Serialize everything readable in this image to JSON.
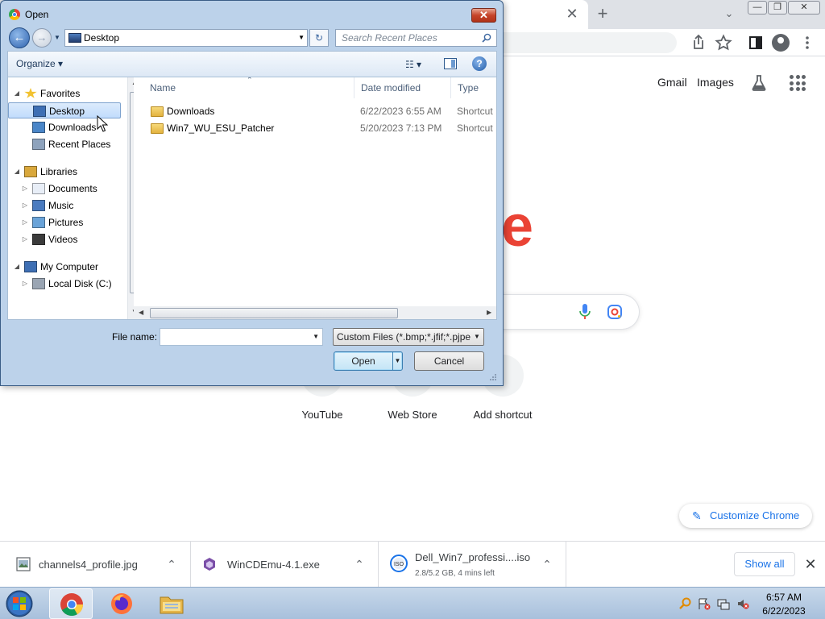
{
  "chrome": {
    "tab_close_glyph": "✕",
    "newtab_glyph": "+",
    "tab_search_glyph": "⌄",
    "window_controls": [
      "—",
      "❐",
      "✕"
    ],
    "toolbar_icons": [
      "share-icon",
      "star-icon",
      "sidepanel-icon",
      "profile-icon",
      "menu-icon"
    ],
    "ntp_links": {
      "gmail": "Gmail",
      "images": "Images"
    },
    "logo_fragment": "e",
    "shortcuts": [
      {
        "label": "YouTube"
      },
      {
        "label": "Web Store"
      },
      {
        "label": "Add shortcut"
      }
    ],
    "customize_label": "Customize Chrome"
  },
  "downloads": {
    "items": [
      {
        "name": "channels4_profile.jpg",
        "status": "",
        "icon": "image-file-icon"
      },
      {
        "name": "WinCDEmu-4.1.exe",
        "status": "",
        "icon": "exe-file-icon"
      },
      {
        "name": "Dell_Win7_professi....iso",
        "status": "2.8/5.2 GB, 4 mins left",
        "icon": "iso-file-icon"
      }
    ],
    "show_all_label": "Show all",
    "close_glyph": "✕"
  },
  "taskbar": {
    "time": "6:57 AM",
    "date": "6/22/2023",
    "apps": [
      "chrome",
      "firefox",
      "explorer"
    ],
    "active_app": "chrome"
  },
  "dialog": {
    "title": "Open",
    "close_glyph": "✕",
    "address": "Desktop",
    "search_placeholder": "Search Recent Places",
    "organize_label": "Organize ▾",
    "view_glyph": "☷ ▾",
    "help_glyph": "?",
    "nav_tree": [
      {
        "label": "Favorites",
        "level": 0,
        "arrow": "◢",
        "icon": "star",
        "selected": false
      },
      {
        "label": "Desktop",
        "level": 1,
        "arrow": "",
        "icon": "desktop",
        "selected": true
      },
      {
        "label": "Downloads",
        "level": 1,
        "arrow": "",
        "icon": "downloads",
        "selected": false
      },
      {
        "label": "Recent Places",
        "level": 1,
        "arrow": "",
        "icon": "recent",
        "selected": false
      },
      {
        "label": "Libraries",
        "level": 0,
        "arrow": "◢",
        "icon": "libraries",
        "selected": false
      },
      {
        "label": "Documents",
        "level": 1,
        "arrow": "▷",
        "icon": "documents",
        "selected": false
      },
      {
        "label": "Music",
        "level": 1,
        "arrow": "▷",
        "icon": "music",
        "selected": false
      },
      {
        "label": "Pictures",
        "level": 1,
        "arrow": "▷",
        "icon": "pictures",
        "selected": false
      },
      {
        "label": "Videos",
        "level": 1,
        "arrow": "▷",
        "icon": "videos",
        "selected": false
      },
      {
        "label": "My Computer",
        "level": 0,
        "arrow": "◢",
        "icon": "computer",
        "selected": false
      },
      {
        "label": "Local Disk (C:)",
        "level": 1,
        "arrow": "▷",
        "icon": "disk",
        "selected": false
      }
    ],
    "columns": {
      "name": "Name",
      "date": "Date modified",
      "type": "Type"
    },
    "files": [
      {
        "name": "Downloads",
        "date": "6/22/2023 6:55 AM",
        "type": "Shortcut"
      },
      {
        "name": "Win7_WU_ESU_Patcher",
        "date": "5/20/2023 7:13 PM",
        "type": "Shortcut"
      }
    ],
    "file_name_label": "File name:",
    "file_name_value": "",
    "file_type_value": "Custom Files (*.bmp;*.jfif;*.pjpe",
    "open_label": "Open",
    "cancel_label": "Cancel"
  }
}
